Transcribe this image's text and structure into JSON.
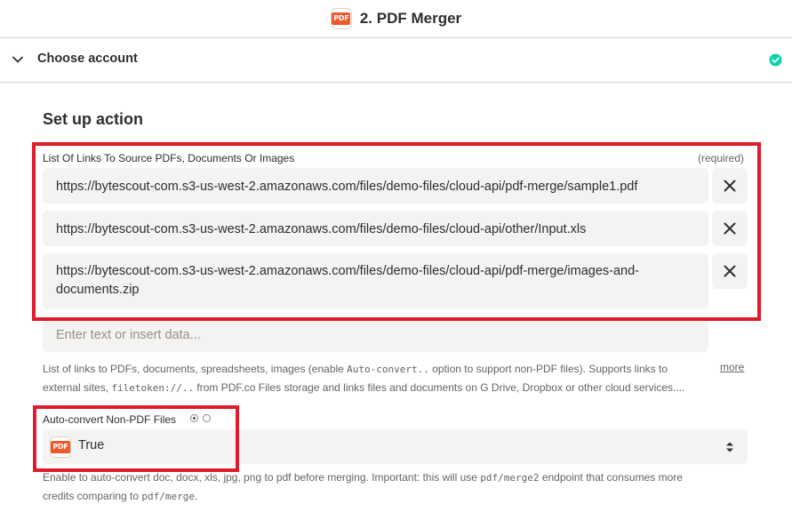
{
  "header": {
    "title": "2. PDF Merger",
    "app_icon_text": "PDF"
  },
  "account": {
    "label": "Choose account"
  },
  "setup": {
    "title": "Set up action",
    "links_field": {
      "label": "List Of Links To Source PDFs, Documents Or Images",
      "required_text": "(required)",
      "urls": [
        "https://bytescout-com.s3-us-west-2.amazonaws.com/files/demo-files/cloud-api/pdf-merge/sample1.pdf",
        "https://bytescout-com.s3-us-west-2.amazonaws.com/files/demo-files/cloud-api/other/Input.xls",
        "https://bytescout-com.s3-us-west-2.amazonaws.com/files/demo-files/cloud-api/pdf-merge/images-and-documents.zip"
      ],
      "placeholder": "Enter text or insert data...",
      "help_1a": "List of links to PDFs, documents, spreadsheets, images (enable ",
      "help_1b": "Auto-convert..",
      "help_1c": " option to support non-PDF files). Supports links to",
      "help_2a": "external sites, ",
      "help_2b": "filetoken://..",
      "help_2c": " from PDF.co Files storage and links files and documents on G Drive, Dropbox or other cloud services....",
      "more_label": "more"
    },
    "autoconvert": {
      "label": "Auto-convert Non-PDF Files",
      "selected_value": "True",
      "help_1a": "Enable to auto-convert doc, docx, xls, jpg, png to pdf before merging. Important: this will use ",
      "help_1b": "pdf/merge2",
      "help_1c": " endpoint that consumes more",
      "help_2a": "credits comparing to ",
      "help_2b": "pdf/merge",
      "help_2c": "."
    }
  },
  "colors": {
    "highlight": "#e01b2c",
    "success": "#13d0ab",
    "pdf_brand": "#f0582a",
    "field_bg": "#f4f3f1"
  },
  "icons": {
    "chevron": "chevron-down-icon",
    "check": "check-circle-icon",
    "remove": "close-icon",
    "select": "updown-arrows-icon"
  }
}
